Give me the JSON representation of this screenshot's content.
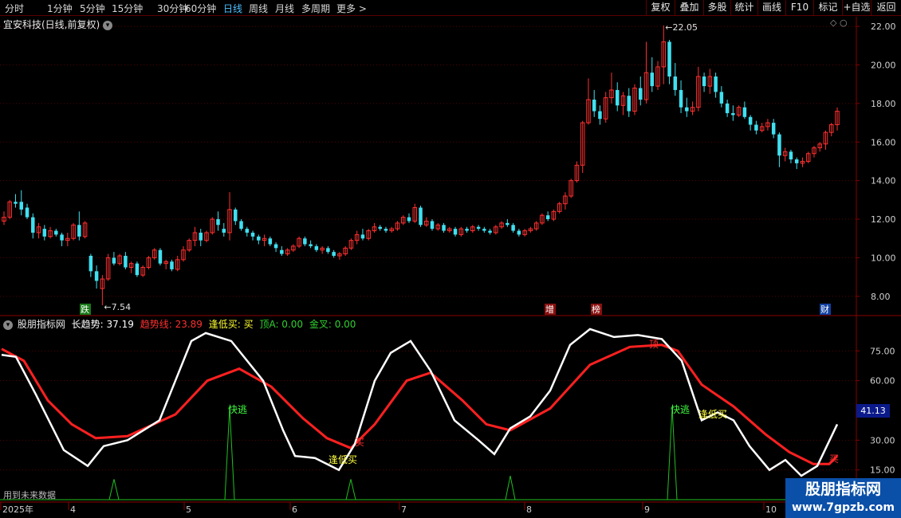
{
  "toolbar": {
    "periods": [
      "分时",
      "1分钟",
      "5分钟",
      "15分钟",
      "30分钟",
      "60分钟",
      "日线",
      "周线",
      "月线",
      "多周期",
      "更多 >"
    ],
    "active_period": "日线",
    "right_buttons": [
      "复权",
      "叠加",
      "多股",
      "统计",
      "画线",
      "F10",
      "标记",
      "+自选",
      "返回"
    ]
  },
  "stock": {
    "title": "宜安科技(日线,前复权)"
  },
  "price_axis": {
    "ticks": [
      "22.00",
      "20.00",
      "18.00",
      "16.00",
      "14.00",
      "12.00",
      "10.00",
      "8.00"
    ]
  },
  "annotations": {
    "high": "22.05",
    "low": "7.54"
  },
  "event_tags": [
    "跌",
    "增",
    "榜",
    "财"
  ],
  "indicator": {
    "name": "股朋指标网",
    "values": [
      {
        "label": "长趋势: 37.19",
        "color": "#ffffff"
      },
      {
        "label": "趋势线: 23.89",
        "color": "#ff3030"
      },
      {
        "label": "逢低买: 买",
        "color": "#ffff30"
      },
      {
        "label": "顶A: 0.00",
        "color": "#30d030"
      },
      {
        "label": "金叉: 0.00",
        "color": "#30d030"
      }
    ],
    "axis_ticks": [
      "75.00",
      "60.00",
      "30.00",
      "15.00"
    ],
    "current_value": "41.13",
    "signals": [
      "快逃",
      "快逃",
      "逢低买",
      "逢低买",
      "买",
      "买",
      "顶"
    ],
    "note": "用到未来数据"
  },
  "time_axis": {
    "labels": [
      "2025年",
      "4",
      "5",
      "6",
      "7",
      "8",
      "9",
      "10"
    ]
  },
  "watermark": {
    "line1": "股朋指标网",
    "line2": "www.7gpzb.com"
  },
  "colors": {
    "up": "#ff3030",
    "down": "#40e0f0",
    "grid": "#5a0000",
    "long_trend": "#ffffff",
    "trend_line": "#ff2020",
    "spike": "#20c020"
  },
  "chart_data": {
    "type": "candlestick",
    "y_range": [
      7.0,
      22.5
    ],
    "candles": [
      [
        11.9,
        12.4,
        11.7,
        12.1
      ],
      [
        12.1,
        13.0,
        12.0,
        12.9
      ],
      [
        12.9,
        13.3,
        12.6,
        12.8
      ],
      [
        12.9,
        13.5,
        12.2,
        12.5
      ],
      [
        12.6,
        12.8,
        12.0,
        12.1
      ],
      [
        12.1,
        12.3,
        11.0,
        11.3
      ],
      [
        11.3,
        11.8,
        11.0,
        11.6
      ],
      [
        11.5,
        11.7,
        10.9,
        11.1
      ],
      [
        11.1,
        11.6,
        11.0,
        11.4
      ],
      [
        11.4,
        11.5,
        11.1,
        11.2
      ],
      [
        11.2,
        11.3,
        10.6,
        10.9
      ],
      [
        10.9,
        11.3,
        10.6,
        11.0
      ],
      [
        11.0,
        11.8,
        10.9,
        11.7
      ],
      [
        11.7,
        12.4,
        10.9,
        11.1
      ],
      [
        11.1,
        11.9,
        11.0,
        11.8
      ],
      [
        10.1,
        10.2,
        9.0,
        9.3
      ],
      [
        9.3,
        9.6,
        8.4,
        8.8
      ],
      [
        8.4,
        9.1,
        7.54,
        8.9
      ],
      [
        8.9,
        10.2,
        8.8,
        10.0
      ],
      [
        10.0,
        10.3,
        9.6,
        9.7
      ],
      [
        9.7,
        10.2,
        9.6,
        10.1
      ],
      [
        10.1,
        10.3,
        9.4,
        9.5
      ],
      [
        9.5,
        9.8,
        9.2,
        9.7
      ],
      [
        9.7,
        9.8,
        9.0,
        9.1
      ],
      [
        9.1,
        9.6,
        9.0,
        9.5
      ],
      [
        9.5,
        10.1,
        9.4,
        10.0
      ],
      [
        10.0,
        10.5,
        9.9,
        10.4
      ],
      [
        10.4,
        10.5,
        9.6,
        9.7
      ],
      [
        9.7,
        9.9,
        9.4,
        9.8
      ],
      [
        9.8,
        9.9,
        9.3,
        9.4
      ],
      [
        9.4,
        10.1,
        9.3,
        9.9
      ],
      [
        9.9,
        10.6,
        9.8,
        10.4
      ],
      [
        10.4,
        11.0,
        10.3,
        10.9
      ],
      [
        10.9,
        11.6,
        10.6,
        11.3
      ],
      [
        11.3,
        11.5,
        10.6,
        10.9
      ],
      [
        10.9,
        11.4,
        10.8,
        11.3
      ],
      [
        11.3,
        12.1,
        11.2,
        12.0
      ],
      [
        12.0,
        12.4,
        11.4,
        11.7
      ],
      [
        11.5,
        11.8,
        11.1,
        11.3
      ],
      [
        11.3,
        13.4,
        10.9,
        12.5
      ],
      [
        12.5,
        12.6,
        11.7,
        11.9
      ],
      [
        11.9,
        12.0,
        11.4,
        11.5
      ],
      [
        11.5,
        11.6,
        11.1,
        11.3
      ],
      [
        11.3,
        11.4,
        10.9,
        11.1
      ],
      [
        11.1,
        11.2,
        10.7,
        10.9
      ],
      [
        10.9,
        11.2,
        10.6,
        11.0
      ],
      [
        11.0,
        11.1,
        10.6,
        10.7
      ],
      [
        10.7,
        10.8,
        10.3,
        10.5
      ],
      [
        10.4,
        10.6,
        10.1,
        10.2
      ],
      [
        10.2,
        10.5,
        10.1,
        10.4
      ],
      [
        10.4,
        10.7,
        10.3,
        10.6
      ],
      [
        10.6,
        11.1,
        10.5,
        11.0
      ],
      [
        11.0,
        11.1,
        10.6,
        10.7
      ],
      [
        10.7,
        10.9,
        10.5,
        10.6
      ],
      [
        10.6,
        10.7,
        10.3,
        10.4
      ],
      [
        10.4,
        10.6,
        10.2,
        10.5
      ],
      [
        10.5,
        10.6,
        10.2,
        10.3
      ],
      [
        10.3,
        10.4,
        10.0,
        10.1
      ],
      [
        10.1,
        10.3,
        9.9,
        10.2
      ],
      [
        10.2,
        10.6,
        10.1,
        10.5
      ],
      [
        10.5,
        11.0,
        10.4,
        10.9
      ],
      [
        10.9,
        11.4,
        10.7,
        11.2
      ],
      [
        11.2,
        11.5,
        10.9,
        11.0
      ],
      [
        11.0,
        11.5,
        10.9,
        11.4
      ],
      [
        11.4,
        11.8,
        11.3,
        11.6
      ],
      [
        11.6,
        11.7,
        11.4,
        11.5
      ],
      [
        11.5,
        11.6,
        11.3,
        11.4
      ],
      [
        11.4,
        11.6,
        11.3,
        11.5
      ],
      [
        11.5,
        11.9,
        11.4,
        11.8
      ],
      [
        11.8,
        12.2,
        11.7,
        12.1
      ],
      [
        12.1,
        12.3,
        11.8,
        11.9
      ],
      [
        11.9,
        12.8,
        11.8,
        12.6
      ],
      [
        12.6,
        12.7,
        11.6,
        11.7
      ],
      [
        11.7,
        12.1,
        11.6,
        11.9
      ],
      [
        11.9,
        12.0,
        11.4,
        11.5
      ],
      [
        11.5,
        11.8,
        11.4,
        11.7
      ],
      [
        11.7,
        11.8,
        11.3,
        11.4
      ],
      [
        11.4,
        11.6,
        11.3,
        11.5
      ],
      [
        11.5,
        11.6,
        11.1,
        11.2
      ],
      [
        11.2,
        11.6,
        11.1,
        11.5
      ],
      [
        11.5,
        11.6,
        11.3,
        11.4
      ],
      [
        11.4,
        11.7,
        11.3,
        11.6
      ],
      [
        11.6,
        11.7,
        11.4,
        11.5
      ],
      [
        11.5,
        11.6,
        11.3,
        11.4
      ],
      [
        11.4,
        11.5,
        11.2,
        11.3
      ],
      [
        11.3,
        11.7,
        11.2,
        11.6
      ],
      [
        11.6,
        11.9,
        11.5,
        11.8
      ],
      [
        11.8,
        12.0,
        11.6,
        11.7
      ],
      [
        11.7,
        11.8,
        11.3,
        11.4
      ],
      [
        11.4,
        11.5,
        11.1,
        11.2
      ],
      [
        11.2,
        11.5,
        11.1,
        11.4
      ],
      [
        11.4,
        11.6,
        11.3,
        11.5
      ],
      [
        11.5,
        11.9,
        11.4,
        11.8
      ],
      [
        11.8,
        12.3,
        11.7,
        12.2
      ],
      [
        12.2,
        12.4,
        11.9,
        12.0
      ],
      [
        12.0,
        12.5,
        11.9,
        12.4
      ],
      [
        12.4,
        12.9,
        12.3,
        12.8
      ],
      [
        12.8,
        13.4,
        12.5,
        13.2
      ],
      [
        13.2,
        14.1,
        13.1,
        14.0
      ],
      [
        14.0,
        15.0,
        13.9,
        14.8
      ],
      [
        14.8,
        17.1,
        14.4,
        17.0
      ],
      [
        17.0,
        19.3,
        16.9,
        18.2
      ],
      [
        18.2,
        18.7,
        17.3,
        17.6
      ],
      [
        17.6,
        17.9,
        16.9,
        17.2
      ],
      [
        17.2,
        18.6,
        17.0,
        18.3
      ],
      [
        18.3,
        19.6,
        18.0,
        18.7
      ],
      [
        18.7,
        19.1,
        17.6,
        17.9
      ],
      [
        17.9,
        18.6,
        17.4,
        18.4
      ],
      [
        18.4,
        18.8,
        17.3,
        17.6
      ],
      [
        17.6,
        19.0,
        17.4,
        18.8
      ],
      [
        18.8,
        19.4,
        17.9,
        18.2
      ],
      [
        18.2,
        21.2,
        18.0,
        19.6
      ],
      [
        19.6,
        20.4,
        18.6,
        18.9
      ],
      [
        18.9,
        20.2,
        18.7,
        19.9
      ],
      [
        19.9,
        22.05,
        19.0,
        21.2
      ],
      [
        21.2,
        21.3,
        19.0,
        19.4
      ],
      [
        19.4,
        20.1,
        18.4,
        18.7
      ],
      [
        18.7,
        19.2,
        17.5,
        17.8
      ],
      [
        17.8,
        18.3,
        17.3,
        17.6
      ],
      [
        17.6,
        18.1,
        17.4,
        17.8
      ],
      [
        17.8,
        19.9,
        17.6,
        19.4
      ],
      [
        19.4,
        19.6,
        18.6,
        18.9
      ],
      [
        18.9,
        19.8,
        18.5,
        19.4
      ],
      [
        19.4,
        19.6,
        18.3,
        18.6
      ],
      [
        18.6,
        18.9,
        17.8,
        18.0
      ],
      [
        18.0,
        18.2,
        17.3,
        17.5
      ],
      [
        17.5,
        17.9,
        17.1,
        17.4
      ],
      [
        17.4,
        17.9,
        17.3,
        17.8
      ],
      [
        17.8,
        18.1,
        17.2,
        17.3
      ],
      [
        17.3,
        17.4,
        16.6,
        16.9
      ],
      [
        16.9,
        17.1,
        16.4,
        16.6
      ],
      [
        16.6,
        17.0,
        16.5,
        16.8
      ],
      [
        16.8,
        17.2,
        16.6,
        17.0
      ],
      [
        17.0,
        17.2,
        16.2,
        16.4
      ],
      [
        16.4,
        16.5,
        14.7,
        15.3
      ],
      [
        15.3,
        15.7,
        15.0,
        15.5
      ],
      [
        15.5,
        15.6,
        14.9,
        15.1
      ],
      [
        15.1,
        15.2,
        14.6,
        14.9
      ],
      [
        14.9,
        15.2,
        14.7,
        15.0
      ],
      [
        15.0,
        15.5,
        14.9,
        15.4
      ],
      [
        15.4,
        15.8,
        15.2,
        15.7
      ],
      [
        15.7,
        16.0,
        15.5,
        15.9
      ],
      [
        15.9,
        16.6,
        15.6,
        16.5
      ],
      [
        16.5,
        17.0,
        16.3,
        16.9
      ],
      [
        16.9,
        17.8,
        16.6,
        17.6
      ]
    ]
  }
}
